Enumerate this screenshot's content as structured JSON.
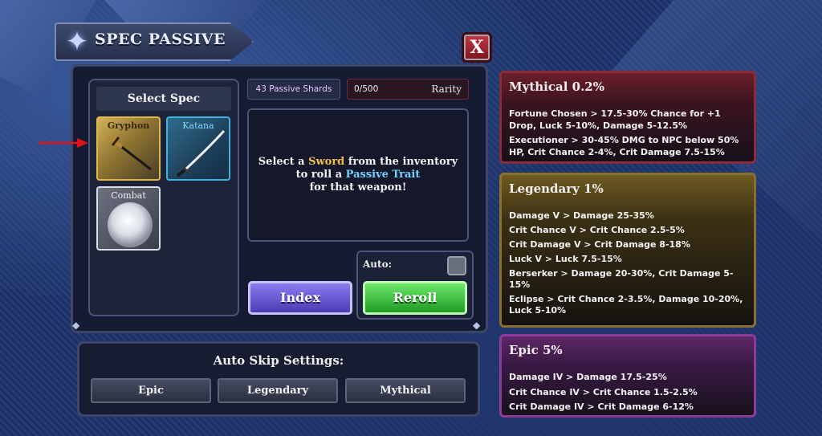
{
  "title": "SPEC PASSIVE",
  "close_label": "X",
  "select_spec": {
    "header": "Select Spec",
    "cards": [
      {
        "label": "Gryphon",
        "icon": "gryphon-sword-icon",
        "selected": true
      },
      {
        "label": "Katana",
        "icon": "katana-icon",
        "selected": false
      },
      {
        "label": "Combat",
        "icon": "combat-orb-icon",
        "selected": false
      }
    ]
  },
  "shards": "43 Passive Shards",
  "rarity_meter": {
    "count": "0/500",
    "label": "Rarity",
    "progress": 0.0
  },
  "info": {
    "part1": "Select a ",
    "sword": "Sword",
    "part2": " from the inventory",
    "part3": "to roll a ",
    "trait": "Passive Trait",
    "part4": "for that weapon!"
  },
  "buttons": {
    "index": "Index",
    "reroll": "Reroll",
    "auto": "Auto:",
    "auto_checked": false
  },
  "auto_skip": {
    "title": "Auto Skip Settings:",
    "options": [
      "Epic",
      "Legendary",
      "Mythical"
    ]
  },
  "rarities": {
    "mythical": {
      "title": "Mythical 0.2%",
      "lines": [
        "Fortune Chosen > 17.5-30% Chance for +1 Drop, Luck 5-10%, Damage 5-12.5%",
        "Executioner > 30-45% DMG to NPC below 50% HP, Crit Chance 2-4%, Crit Damage 7.5-15%"
      ]
    },
    "legendary": {
      "title": "Legendary 1%",
      "lines": [
        "Damage V > Damage 25-35%",
        "Crit Chance V > Crit Chance 2.5-5%",
        "Crit Damage V > Crit Damage 8-18%",
        "Luck V > Luck 7.5-15%",
        "Berserker > Damage 20-30%, Crit Damage 5-15%",
        "Eclipse > Crit Chance 2-3.5%, Damage 10-20%, Luck 5-10%"
      ]
    },
    "epic": {
      "title": "Epic 5%",
      "lines": [
        "Damage IV > Damage 17.5-25%",
        "Crit Chance IV > Crit Chance 1.5-2.5%",
        "Crit Damage IV > Crit Damage 6-12%"
      ]
    }
  },
  "colors": {
    "mythical": "#8a2d3a",
    "legendary": "#8a7030",
    "epic": "#8e3a98",
    "index_button": "#6a5cd8",
    "reroll_button": "#3cc23f",
    "annotation_arrow": "#e0141c"
  }
}
